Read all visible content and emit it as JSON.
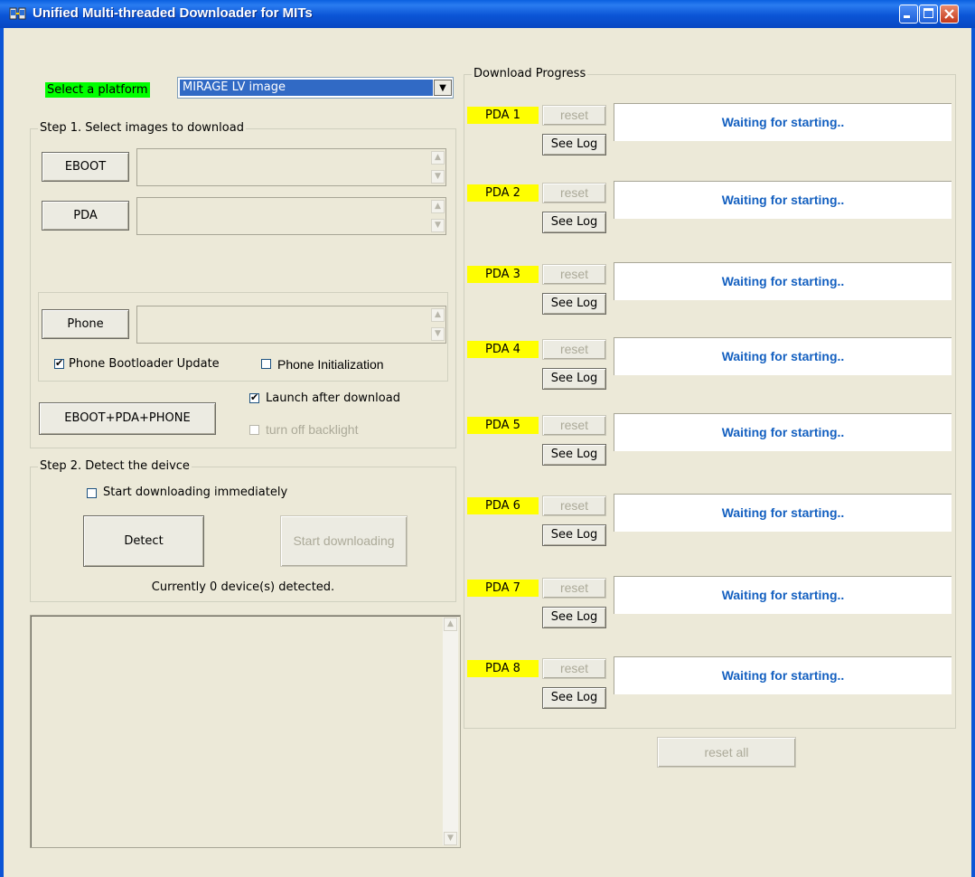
{
  "window": {
    "title": "Unified Multi-threaded Downloader for MITs"
  },
  "platform": {
    "label": "Select a platform",
    "selected": "MIRAGE LV image",
    "dropdown_arrow": "▼"
  },
  "step1": {
    "legend": "Step 1. Select images to download",
    "eboot_button": "EBOOT",
    "pda_button": "PDA",
    "phone_button": "Phone",
    "phone_bootloader_update": {
      "label": "Phone Bootloader Update",
      "checked": true
    },
    "phone_initialization": {
      "label": "Phone Initialization",
      "checked": false
    },
    "launch_after_download": {
      "label": "Launch after download",
      "checked": true
    },
    "turn_off_backlight": {
      "label": "turn off backlight",
      "checked": false
    },
    "combo_button": "EBOOT+PDA+PHONE"
  },
  "step2": {
    "legend": "Step 2. Detect the deivce",
    "start_immediately": {
      "label": "Start downloading immediately",
      "checked": false
    },
    "detect_button": "Detect",
    "start_button": "Start downloading",
    "detected_text": "Currently 0 device(s) detected."
  },
  "progress": {
    "legend": "Download Progress",
    "reset_label": "reset",
    "see_log_label": "See Log",
    "reset_all_label": "reset all",
    "devices": [
      {
        "name": "PDA 1",
        "status": "Waiting for starting.."
      },
      {
        "name": "PDA 2",
        "status": "Waiting for starting.."
      },
      {
        "name": "PDA 3",
        "status": "Waiting for starting.."
      },
      {
        "name": "PDA 4",
        "status": "Waiting for starting.."
      },
      {
        "name": "PDA 5",
        "status": "Waiting for starting.."
      },
      {
        "name": "PDA 6",
        "status": "Waiting for starting.."
      },
      {
        "name": "PDA 7",
        "status": "Waiting for starting.."
      },
      {
        "name": "PDA 8",
        "status": "Waiting for starting.."
      }
    ]
  },
  "colors": {
    "platform_label_bg": "#00ff00",
    "pda_label_bg": "#ffff00",
    "status_text": "#1460c0",
    "titlebar": "#0b55d6"
  }
}
